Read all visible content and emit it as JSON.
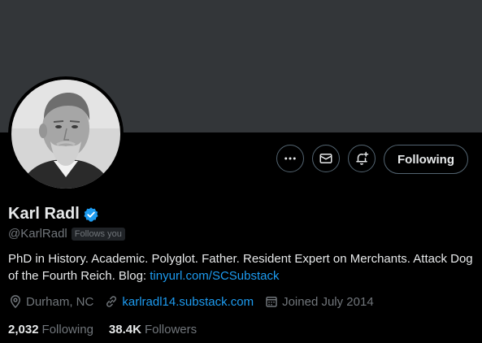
{
  "profile": {
    "name": "Karl Radl",
    "handle": "@KarlRadl",
    "follows_you": "Follows you",
    "bio_text": "PhD in History. Academic. Polyglot. Father. Resident Expert on Merchants. Attack Dog of the Fourth Reich. Blog: ",
    "bio_link": "tinyurl.com/SCSubstack",
    "location": "Durham, NC",
    "website": "karlradl14.substack.com",
    "joined": "Joined July 2014",
    "following_count": "2,032",
    "following_label": "Following",
    "followers_count": "38.4K",
    "followers_label": "Followers",
    "avatar_icon": "avatar-portrait"
  },
  "actions": {
    "more_icon": "more-icon",
    "message_icon": "mail-icon",
    "notify_icon": "bell-plus-icon",
    "follow_button_label": "Following"
  },
  "colors": {
    "background": "#000000",
    "banner": "#333639",
    "primary_text": "#e7e9ea",
    "secondary_text": "#71767b",
    "link": "#1d9bf0",
    "verified": "#1d9bf0",
    "border": "#536471"
  }
}
